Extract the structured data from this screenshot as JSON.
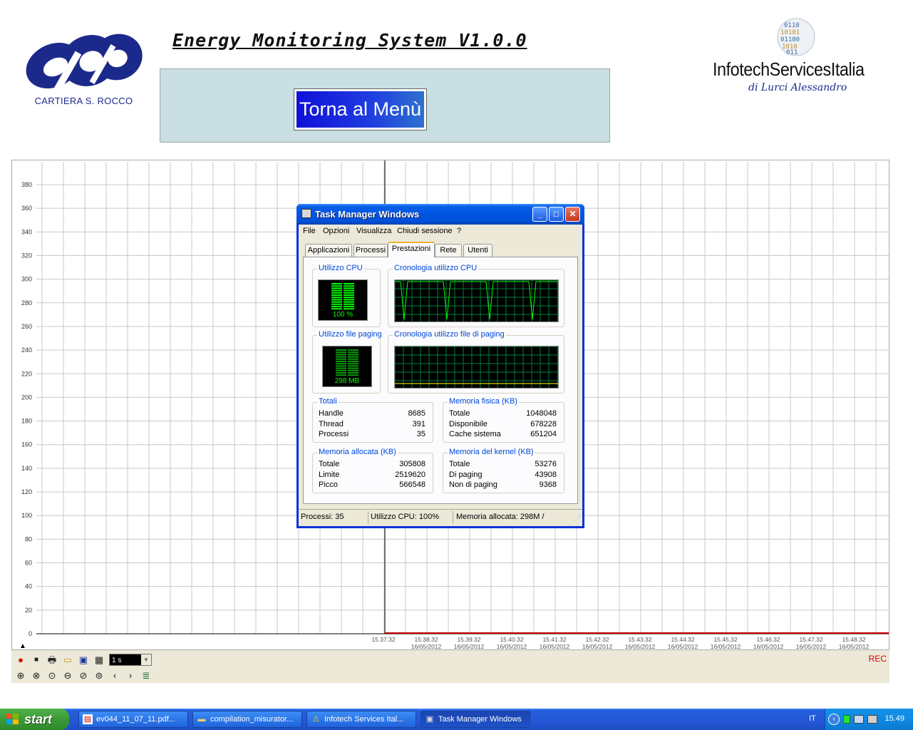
{
  "header": {
    "title": "Energy Monitoring System V1.0.0",
    "menu_button": "Torna al Menù",
    "left_logo_caption": "CARTIERA S. ROCCO",
    "right_logo_brand": "InfotechServicesItalia",
    "right_logo_sub": "di Lurci Alessandro"
  },
  "chart": {
    "y_ticks": [
      "380",
      "360",
      "340",
      "320",
      "300",
      "280",
      "260",
      "240",
      "220",
      "200",
      "180",
      "160",
      "140",
      "120",
      "100",
      "80",
      "60",
      "40",
      "20",
      "0"
    ],
    "x_ticks": [
      {
        "time": "15.37.32",
        "date": ""
      },
      {
        "time": "15.38.32",
        "date": "16/05/2012"
      },
      {
        "time": "15.39.32",
        "date": "16/05/2012"
      },
      {
        "time": "15.40.32",
        "date": "16/05/2012"
      },
      {
        "time": "15.41.32",
        "date": "16/05/2012"
      },
      {
        "time": "15.42.32",
        "date": "16/05/2012"
      },
      {
        "time": "15.43.32",
        "date": "16/05/2012"
      },
      {
        "time": "15.44.32",
        "date": "16/05/2012"
      },
      {
        "time": "15.45.32",
        "date": "16/05/2012"
      },
      {
        "time": "15.46.32",
        "date": "16/05/2012"
      },
      {
        "time": "15.47.32",
        "date": "16/05/2012"
      },
      {
        "time": "15.48.32",
        "date": "16/05/2012"
      }
    ],
    "line_color": "#cc0000",
    "grid_color": "#c8c8c8"
  },
  "chart_toolbar": {
    "interval": "1 s",
    "rec": "REC",
    "prev": "‹",
    "next": "›"
  },
  "task_manager": {
    "title": "Task Manager Windows",
    "menu": [
      "File",
      "Opzioni",
      "Visualizza",
      "Chiudi sessione",
      "?"
    ],
    "tabs": [
      "Applicazioni",
      "Processi",
      "Prestazioni",
      "Rete",
      "Utenti"
    ],
    "active_tab": "Prestazioni",
    "cpu_label": "Utilizzo CPU",
    "cpu_value": "100 %",
    "cpu_level": 1.0,
    "cpu_history_label": "Cronologia utilizzo CPU",
    "paging_label": "Utilizzo file paging",
    "paging_value": "298 MB",
    "paging_history_label": "Cronologia utilizzo file di paging",
    "totali": {
      "label": "Totali",
      "rows": [
        {
          "name": "Handle",
          "value": "8685"
        },
        {
          "name": "Thread",
          "value": "391"
        },
        {
          "name": "Processi",
          "value": "35"
        }
      ]
    },
    "memoria_fisica": {
      "label": "Memoria fisica (KB)",
      "rows": [
        {
          "name": "Totale",
          "value": "1048048"
        },
        {
          "name": "Disponibile",
          "value": "678228"
        },
        {
          "name": "Cache sistema",
          "value": "651204"
        }
      ]
    },
    "memoria_allocata": {
      "label": "Memoria allocata (KB)",
      "rows": [
        {
          "name": "Totale",
          "value": "305808"
        },
        {
          "name": "Limite",
          "value": "2519620"
        },
        {
          "name": "Picco",
          "value": "566548"
        }
      ]
    },
    "memoria_kernel": {
      "label": "Memoria del kernel (KB)",
      "rows": [
        {
          "name": "Totale",
          "value": "53276"
        },
        {
          "name": "Di paging",
          "value": "43908"
        },
        {
          "name": "Non di paging",
          "value": "9368"
        }
      ]
    },
    "status": {
      "processes": "Processi: 35",
      "cpu": "Utilizzo CPU: 100%",
      "memory": "Memoria allocata: 298M /"
    }
  },
  "taskbar": {
    "start": "start",
    "items": [
      {
        "label": "ev044_11_07_11.pdf...",
        "icon": "pdf-icon"
      },
      {
        "label": "compilation_misurator...",
        "icon": "folder-icon"
      },
      {
        "label": "Infotech Services Ital...",
        "icon": "warning-icon"
      },
      {
        "label": "Task Manager Windows",
        "icon": "taskmanager-icon"
      }
    ],
    "language": "IT",
    "clock": "15.49"
  }
}
